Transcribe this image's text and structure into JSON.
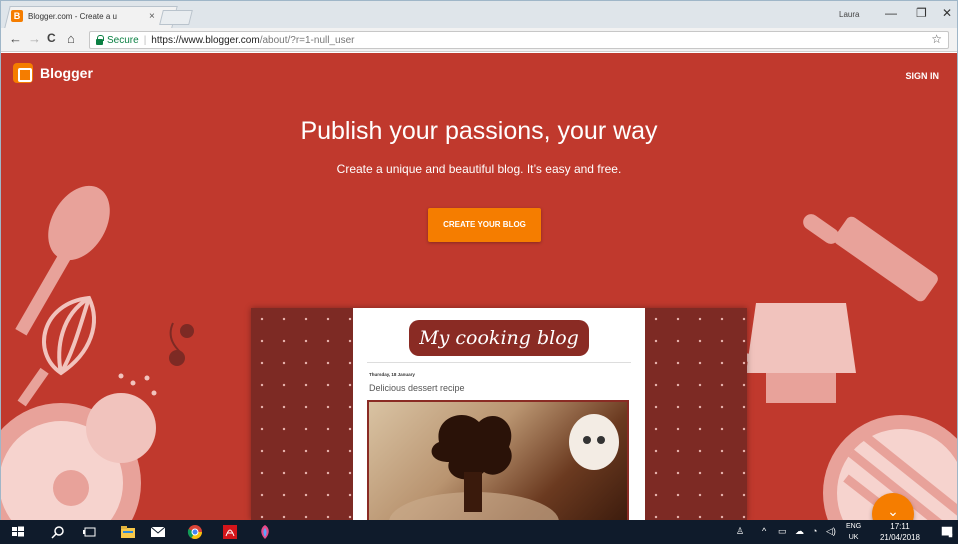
{
  "browser": {
    "tab_title": "Blogger.com - Create a u",
    "tab_close": "×",
    "profile_name": "Laura",
    "controls": {
      "minimize": "—",
      "maximize": "❐",
      "close": "✕"
    },
    "nav": {
      "back": "←",
      "forward": "→",
      "reload": "C",
      "home": "⌂"
    },
    "secure_label": "Secure",
    "url_main": "https://www.blogger.com",
    "url_path": "/about/?r=1-null_user",
    "star": "☆"
  },
  "page": {
    "brand_name": "Blogger",
    "signin_label": "SIGN IN",
    "hero_title": "Publish your passions, your way",
    "hero_subtitle": "Create a unique and beautiful blog. It’s easy and free.",
    "cta_label": "CREATE YOUR BLOG",
    "scroll_fab": "⌄",
    "colors": {
      "background": "#c0392d",
      "accent": "#f57d00",
      "illustration": "#e8a29a"
    }
  },
  "preview": {
    "blog_title": "My cooking blog",
    "post_date": "Thursday, 18 January",
    "post_title": "Delicious dessert recipe"
  },
  "taskbar": {
    "language_top": "ENG",
    "language_bottom": "UK",
    "time": "17:11",
    "date": "21/04/2018"
  }
}
